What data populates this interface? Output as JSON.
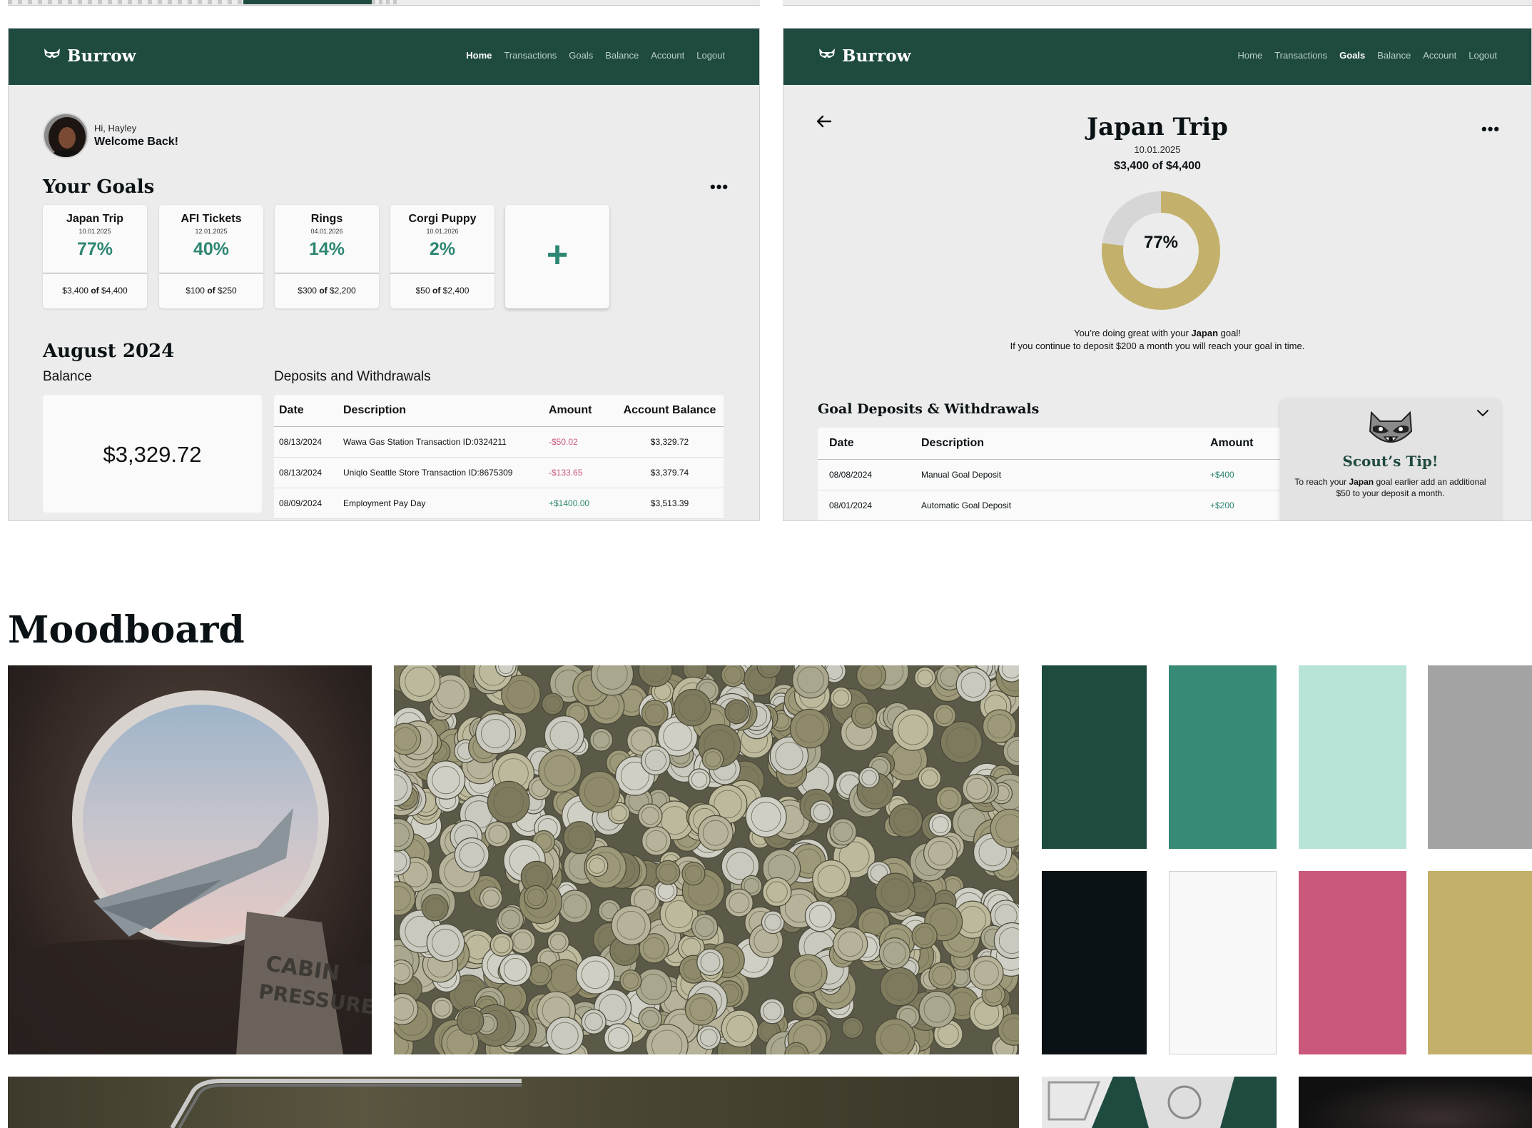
{
  "app": {
    "brand": "Burrow",
    "nav": [
      "Home",
      "Transactions",
      "Goals",
      "Balance",
      "Account",
      "Logout"
    ]
  },
  "home": {
    "active_nav": "Home",
    "greeting_small": "Hi, Hayley",
    "greeting_big": "Welcome Back!",
    "goals_title": "Your Goals",
    "more": "•••",
    "goals": [
      {
        "name": "Japan Trip",
        "date": "10.01.2025",
        "percent": "77%",
        "saved": "$3,400",
        "of_word": "of",
        "target": "$4,400"
      },
      {
        "name": "AFI Tickets",
        "date": "12.01.2025",
        "percent": "40%",
        "saved": "$100",
        "of_word": "of",
        "target": "$250"
      },
      {
        "name": "Rings",
        "date": "04.01.2026",
        "percent": "14%",
        "saved": "$300",
        "of_word": "of",
        "target": "$2,200"
      },
      {
        "name": "Corgi Puppy",
        "date": "10.01.2026",
        "percent": "2%",
        "saved": "$50",
        "of_word": "of",
        "target": "$2,400"
      }
    ],
    "add_symbol": "+",
    "month_title": "August 2024",
    "balance_label": "Balance",
    "balance_value": "$3,329.72",
    "transactions_label": "Deposits and Withdrawals",
    "table_headers": [
      "Date",
      "Description",
      "Amount",
      "Account Balance"
    ],
    "transactions": [
      {
        "date": "08/13/2024",
        "description": "Wawa Gas Station Transaction ID:0324211",
        "amount": "-$50.02",
        "balance": "$3,329.72",
        "type": "neg"
      },
      {
        "date": "08/13/2024",
        "description": "Uniqlo Seattle Store Transaction ID:8675309",
        "amount": "-$133.65",
        "balance": "$3,379.74",
        "type": "neg"
      },
      {
        "date": "08/09/2024",
        "description": "Employment Pay Day",
        "amount": "+$1400.00",
        "balance": "$3,513.39",
        "type": "pos"
      }
    ]
  },
  "goal_detail": {
    "active_nav": "Goals",
    "title": "Japan Trip",
    "date": "10.01.2025",
    "amount_line": "$3,400 of $4,400",
    "progress_percent": 77,
    "progress_label": "77%",
    "encourage_1_pre": "You’re doing great with your ",
    "encourage_1_bold": "Japan",
    "encourage_1_post": " goal!",
    "encourage_2": "If you continue to deposit $200 a month you will reach your goal in time.",
    "more": "•••",
    "table_title": "Goal Deposits & Withdrawals",
    "table_headers": [
      "Date",
      "Description",
      "Amount"
    ],
    "rows": [
      {
        "date": "08/08/2024",
        "description": "Manual Goal Deposit",
        "amount": "+$400"
      },
      {
        "date": "08/01/2024",
        "description": "Automatic Goal Deposit",
        "amount": "+$200"
      }
    ],
    "tip_title": "Scout’s Tip!",
    "tip_pre": "To reach your ",
    "tip_bold": "Japan",
    "tip_post": " goal earlier add an additional $50 to your deposit a month."
  },
  "moodboard": {
    "title": "Moodboard",
    "cabin_text_1": "CABIN",
    "cabin_text_2": "PRESSURE",
    "palette": [
      "#1f4a40",
      "#368a76",
      "#b8e3d9",
      "#a3a3a3",
      "#0b1215",
      "#f8f8f8",
      "#c9587a",
      "#c3b06a"
    ]
  },
  "colors": {
    "primary": "#1f4a40",
    "accent": "#2e8773",
    "negative": "#c9587a",
    "gold": "#c3b06a",
    "background": "#ececec"
  }
}
